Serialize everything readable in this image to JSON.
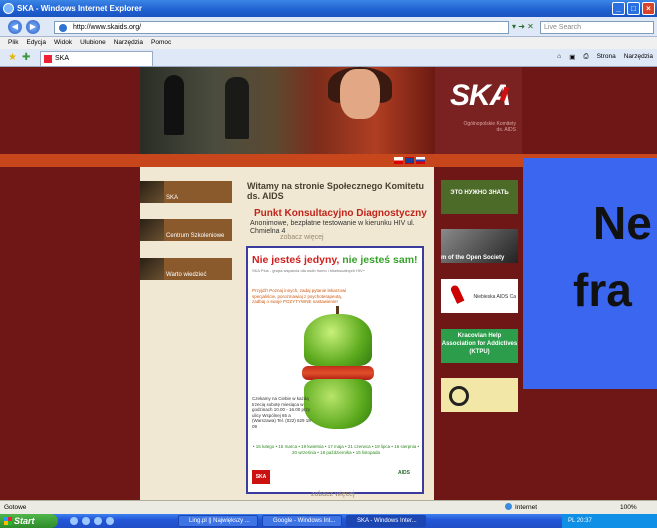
{
  "window": {
    "title": "SKA - Windows Internet Explorer"
  },
  "address": {
    "url": "http://www.skaids.org/",
    "search_placeholder": "Live Search"
  },
  "menu": [
    "Plik",
    "Edycja",
    "Widok",
    "Ulubione",
    "Narzędzia",
    "Pomoc"
  ],
  "tab": {
    "label": "SKA"
  },
  "commandbar": {
    "page": "Strona",
    "tools": "Narzędzia"
  },
  "site": {
    "logo": "SKA",
    "logo_caption": "Ogólnopolskie Komitety ds. AIDS",
    "sidebar": [
      "SKA",
      "Centrum Szkoleniowe",
      "Warto wiedzieć"
    ],
    "welcome": "Witamy na stronie Społecznego Komitetu ds. AIDS",
    "pkd_title": "Punkt Konsultacyjno Diagnostyczny",
    "pkd_desc": "Anonimowe, bezpłatne testowanie w kierunku HIV ul. Chmielna 4",
    "more1": "zobacz więcej",
    "more2": "zobacz więcej",
    "poster": {
      "title_red": "Nie jesteś jedyny, ",
      "title_green": "nie jesteś sam!",
      "subtitle": "SKA Plus - grupa wsparcia dla osób homo i biseksualnych HIV+",
      "info": "Przyjdź! Poznaj innych, zadaj pytanie lekarzowi specjaliście, porozmawiaj z psychoterapeutą, zadbaj o swoje POZYTYWNE nastawienie!",
      "contact": "Czekamy na Ciebie w każdą trzecią sobotę miesiąca w godzinach 10.00 - 16.00 przy ulicy Wspólnej 65 a (Warszawa) Tel. (022) 629 18 09",
      "dates": "• 16 lutego • 15 marca • 19 kwietnia • 17 maja • 21 czerwca • 19 lipca • 16 sierpnia • 20 września • 18 października • 15 listopada",
      "aids": "AIDS"
    },
    "right_banners": {
      "b1": "ЭТО НУЖНО ЗНАТЬ",
      "b2": "m of the Open Society",
      "b3": "Niebieska AIDS Ca",
      "b4": "Kracovian Help Association for Addictives (KTPU)"
    }
  },
  "overlay": {
    "line1": "Ne",
    "line2": "fra"
  },
  "status": {
    "left": "Gotowe",
    "zone": "Internet",
    "zoom": "100%"
  },
  "taskbar": {
    "start": "Start",
    "tasks": [
      "Ling.pl || Największy ...",
      "Google - Windows Int...",
      "SKA - Windows Inter..."
    ],
    "tray": "PL  20:37"
  }
}
